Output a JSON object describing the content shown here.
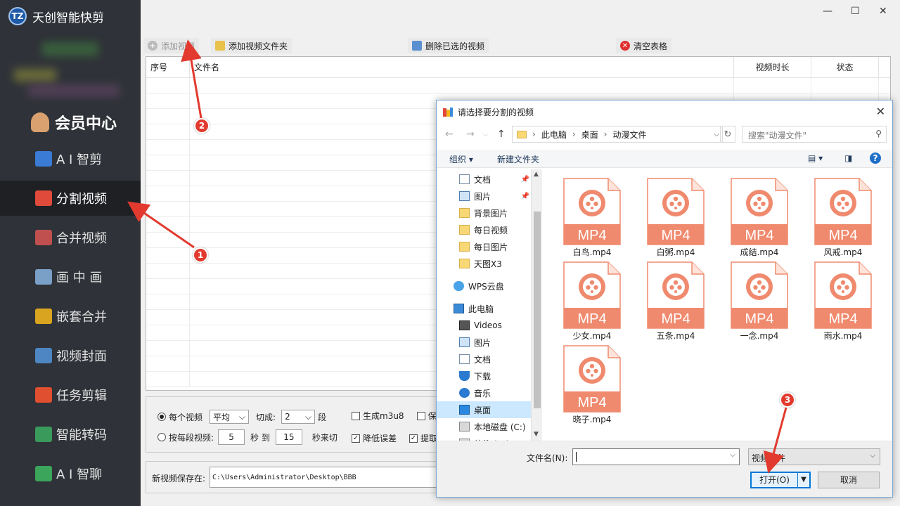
{
  "app": {
    "title": "天创智能快剪",
    "logo_text": "TZ",
    "member_center": "会员中心"
  },
  "sidebar": {
    "items": [
      {
        "label": "A I 智剪",
        "icon": "ai-cut-icon",
        "color": "#3a7bd5"
      },
      {
        "label": "分割视频",
        "icon": "split-video-icon",
        "color": "#e04a3b",
        "active": true
      },
      {
        "label": "合并视频",
        "icon": "merge-video-icon",
        "color": "#c05050"
      },
      {
        "label": "画 中 画",
        "icon": "picture-in-picture-icon",
        "color": "#7aa0c8"
      },
      {
        "label": "嵌套合并",
        "icon": "nested-merge-icon",
        "color": "#d9a520"
      },
      {
        "label": "视频封面",
        "icon": "video-cover-icon",
        "color": "#4d86c2"
      },
      {
        "label": "任务剪辑",
        "icon": "task-edit-icon",
        "color": "#e05030"
      },
      {
        "label": "智能转码",
        "icon": "smart-transcode-icon",
        "color": "#3a9a5b"
      },
      {
        "label": "A I 智聊",
        "icon": "ai-chat-icon",
        "color": "#3aa55b"
      }
    ]
  },
  "window_controls": {
    "minimize": "—",
    "maximize": "☐",
    "close": "✕"
  },
  "toolbar": {
    "add_video": "添加视频",
    "add_folder": "添加视频文件夹",
    "delete_selected": "删除已选的视频",
    "clear_table": "清空表格"
  },
  "table": {
    "columns": [
      "序号",
      "文件名",
      "视频时长",
      "状态"
    ]
  },
  "options": {
    "each_video": "每个视频",
    "mode_value": "平均",
    "cut_into": "切成:",
    "segments_value": "2",
    "segment_unit": "段",
    "gen_m3u8": "生成m3u8",
    "keep_partial": "保留",
    "per_segment": "按每段视频:",
    "from_value": "5",
    "sec_to": "秒 到",
    "to_value": "15",
    "sec_cut": "秒来切",
    "reduce_error": "降低误差",
    "extract_partial": "提取"
  },
  "save": {
    "label": "新视频保存在:",
    "path": "C:\\Users\\Administrator\\Desktop\\BBB"
  },
  "dialog": {
    "title": "请选择要分割的视频",
    "breadcrumb": [
      "此电脑",
      "桌面",
      "动漫文件"
    ],
    "search_placeholder": "搜索\"动漫文件\"",
    "organize": "组织 ▾",
    "new_folder": "新建文件夹",
    "tree": [
      {
        "label": "文档",
        "icon": "document-icon",
        "pinned": true
      },
      {
        "label": "图片",
        "icon": "picture-icon",
        "pinned": true
      },
      {
        "label": "背景图片",
        "icon": "folder-icon"
      },
      {
        "label": "每日视频",
        "icon": "folder-icon"
      },
      {
        "label": "每日图片",
        "icon": "folder-icon"
      },
      {
        "label": "天图X3",
        "icon": "folder-icon"
      },
      {
        "label": "WPS云盘",
        "icon": "cloud-icon"
      },
      {
        "label": "此电脑",
        "icon": "computer-icon"
      },
      {
        "label": "Videos",
        "icon": "videos-icon"
      },
      {
        "label": "图片",
        "icon": "picture-icon"
      },
      {
        "label": "文档",
        "icon": "document-icon"
      },
      {
        "label": "下载",
        "icon": "download-icon"
      },
      {
        "label": "音乐",
        "icon": "music-icon"
      },
      {
        "label": "桌面",
        "icon": "desktop-icon",
        "selected": true
      },
      {
        "label": "本地磁盘 (C:)",
        "icon": "disk-icon"
      },
      {
        "label": "软件 (D:)",
        "icon": "disk-icon"
      }
    ],
    "files": [
      {
        "name": "白鸟.mp4"
      },
      {
        "name": "白粥.mp4"
      },
      {
        "name": "成结.mp4"
      },
      {
        "name": "风戒.mp4"
      },
      {
        "name": "少女.mp4"
      },
      {
        "name": "五条.mp4"
      },
      {
        "name": "一念.mp4"
      },
      {
        "name": "雨水.mp4"
      },
      {
        "name": "晓子.mp4"
      }
    ],
    "file_badge": "MP4",
    "filename_label": "文件名(N):",
    "filetype": "视频文件",
    "open": "打开(O)",
    "cancel": "取消"
  },
  "annotations": [
    "1",
    "2",
    "3"
  ],
  "colors": {
    "sidebar_bg": "#2f3238",
    "mp4_accent": "#f08a6e",
    "annotation_red": "#e23a2e"
  }
}
